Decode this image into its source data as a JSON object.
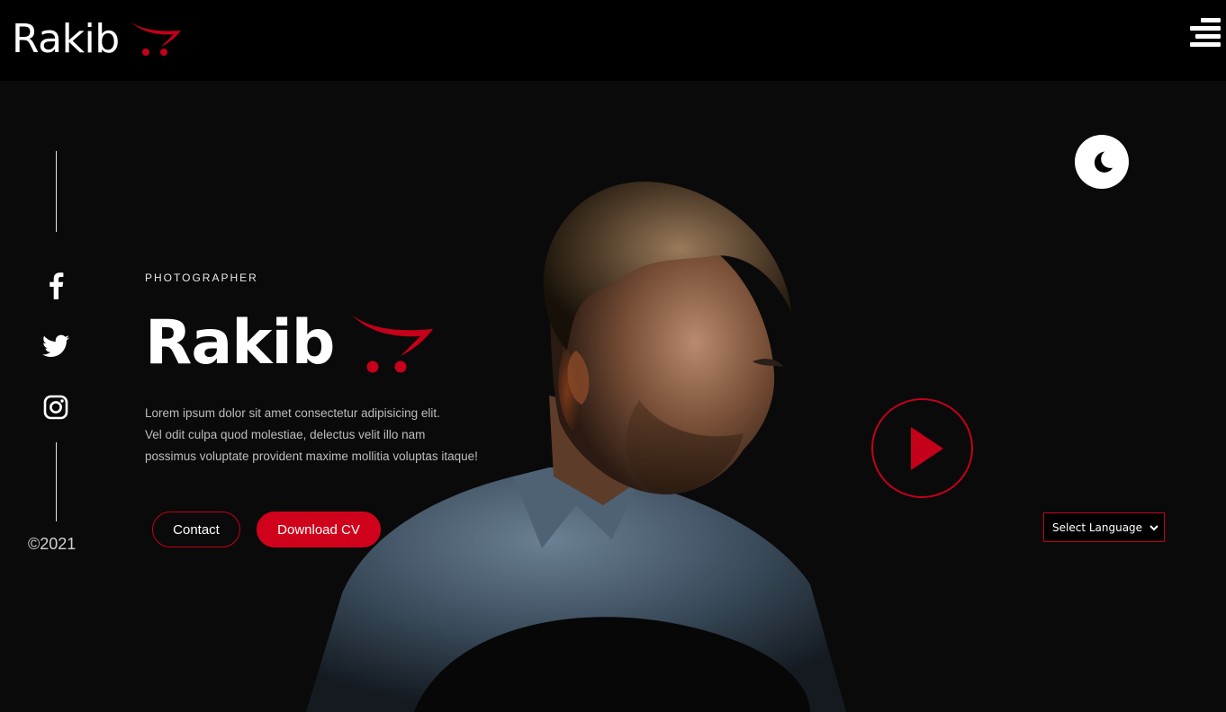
{
  "header": {
    "brand_name": "Rakib",
    "menu_icon": "hamburger-menu-icon"
  },
  "sidebar": {
    "social": [
      {
        "name": "facebook",
        "icon": "facebook-icon"
      },
      {
        "name": "twitter",
        "icon": "twitter-icon"
      },
      {
        "name": "instagram",
        "icon": "instagram-icon"
      }
    ],
    "copyright": "©2021"
  },
  "hero": {
    "eyebrow": "PHOTOGRAPHER",
    "name": "Rakib",
    "description_lines": [
      "Lorem ipsum dolor sit amet consectetur adipisicing elit.",
      "Vel odit culpa quod molestiae, delectus velit illo nam",
      "possimus voluptate provident maxime mollitia voluptas itaque!"
    ],
    "contact_label": "Contact",
    "download_label": "Download CV"
  },
  "controls": {
    "theme_icon": "moon-icon",
    "play_icon": "play-icon",
    "language_select": "Select Language"
  },
  "colors": {
    "accent": "#d0021b",
    "background": "#0a0a0a",
    "topbar": "#000000",
    "text": "#ffffff"
  }
}
